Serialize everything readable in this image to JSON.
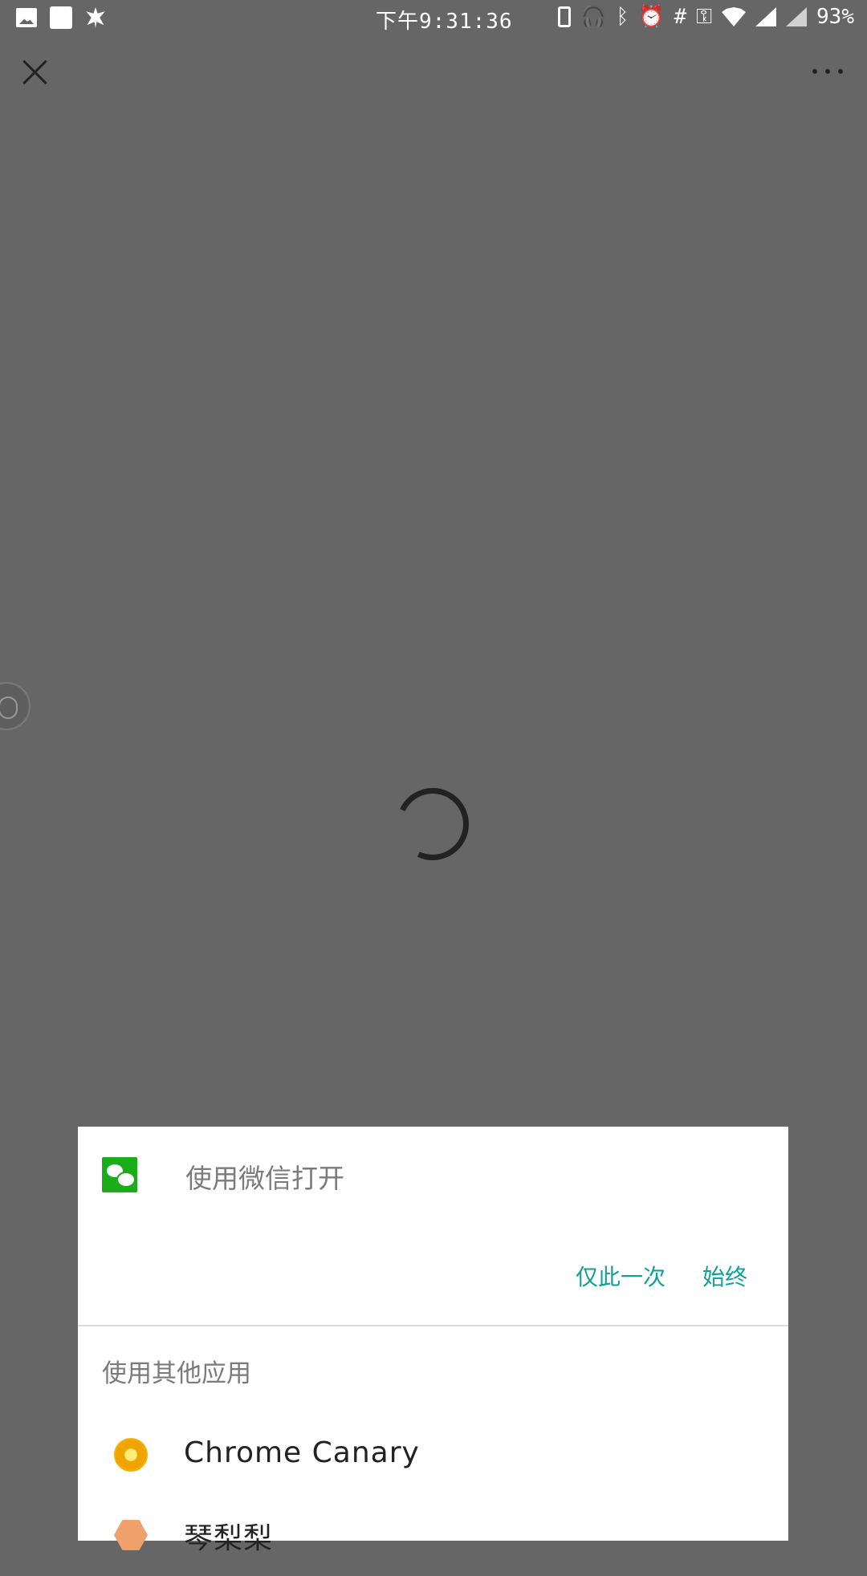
{
  "status_bar": {
    "time": "下午9:31:36",
    "battery": "93%",
    "icons_left": [
      "image-icon",
      "white-square-icon",
      "maple-leaf-icon"
    ],
    "icons_right": [
      "phone-icon",
      "headphones-icon",
      "bluetooth-icon",
      "alarm-icon",
      "hash-icon",
      "vpn-key-icon",
      "wifi-icon",
      "signal-icon",
      "signal-icon"
    ]
  },
  "sheet": {
    "title": "使用微信打开",
    "actions": {
      "just_once": "仅此一次",
      "always": "始终"
    },
    "other_apps_title": "使用其他应用",
    "apps": [
      {
        "label": "Chrome Canary",
        "icon": "chrome-canary-icon"
      },
      {
        "label": "琴梨梨",
        "icon": "qinlili-icon"
      }
    ]
  },
  "colors": {
    "overlay": "#666666",
    "accent": "#11a098",
    "wechat_green": "#1aad19"
  }
}
